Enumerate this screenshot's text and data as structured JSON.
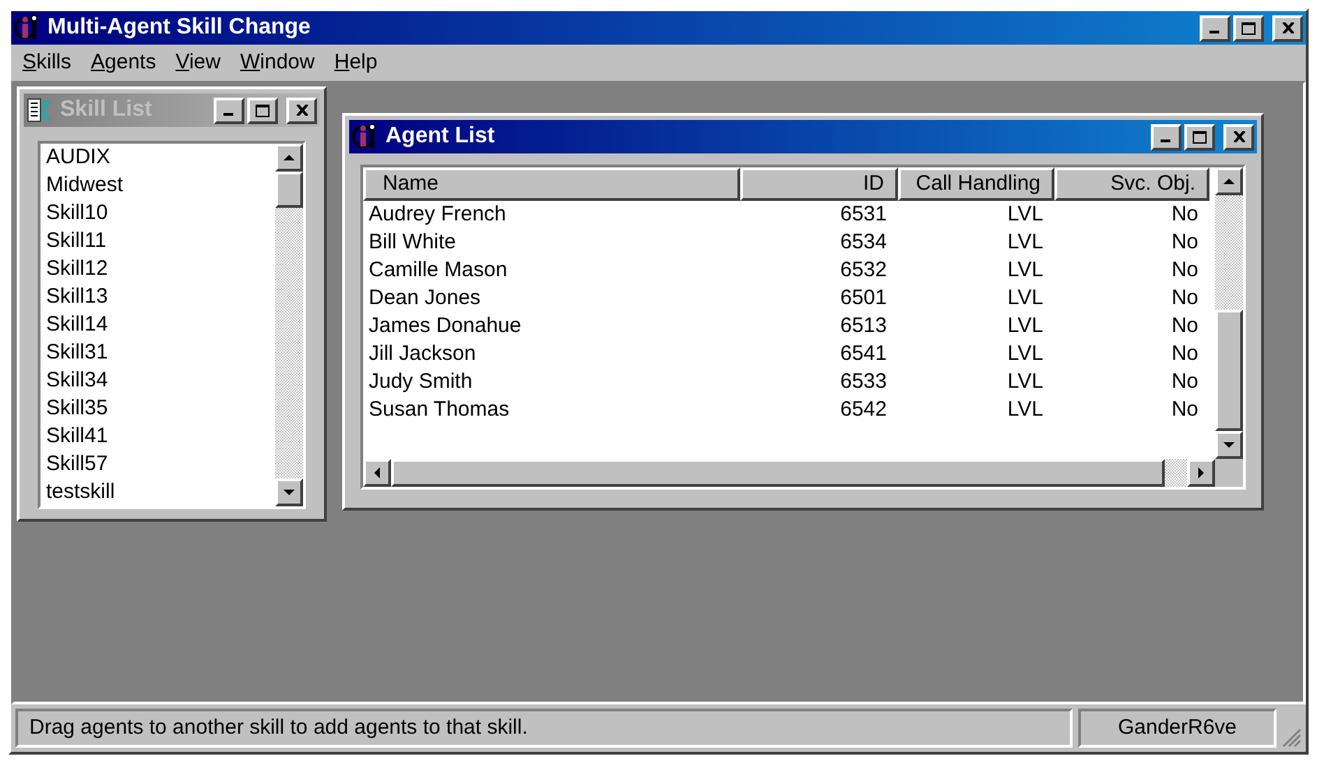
{
  "window": {
    "title": "Multi-Agent Skill Change"
  },
  "menu": [
    "Skills",
    "Agents",
    "View",
    "Window",
    "Help"
  ],
  "skill_list": {
    "title": "Skill List",
    "active": false,
    "items": [
      "AUDIX",
      "Midwest",
      "Skill10",
      "Skill11",
      "Skill12",
      "Skill13",
      "Skill14",
      "Skill31",
      "Skill34",
      "Skill35",
      "Skill41",
      "Skill57",
      "testskill"
    ]
  },
  "agent_list": {
    "title": "Agent List",
    "active": true,
    "columns": [
      "Name",
      "ID",
      "Call Handling",
      "Svc. Obj."
    ],
    "rows": [
      [
        "Audrey French",
        "6531",
        "LVL",
        "No"
      ],
      [
        "Bill White",
        "6534",
        "LVL",
        "No"
      ],
      [
        "Camille Mason",
        "6532",
        "LVL",
        "No"
      ],
      [
        "Dean Jones",
        "6501",
        "LVL",
        "No"
      ],
      [
        "James Donahue",
        "6513",
        "LVL",
        "No"
      ],
      [
        "Jill Jackson",
        "6541",
        "LVL",
        "No"
      ],
      [
        "Judy Smith",
        "6533",
        "LVL",
        "No"
      ],
      [
        "Susan Thomas",
        "6542",
        "LVL",
        "No"
      ]
    ]
  },
  "status_bar": {
    "message": "Drag agents to another skill to add agents to that skill.",
    "user": "GanderR6ve"
  }
}
